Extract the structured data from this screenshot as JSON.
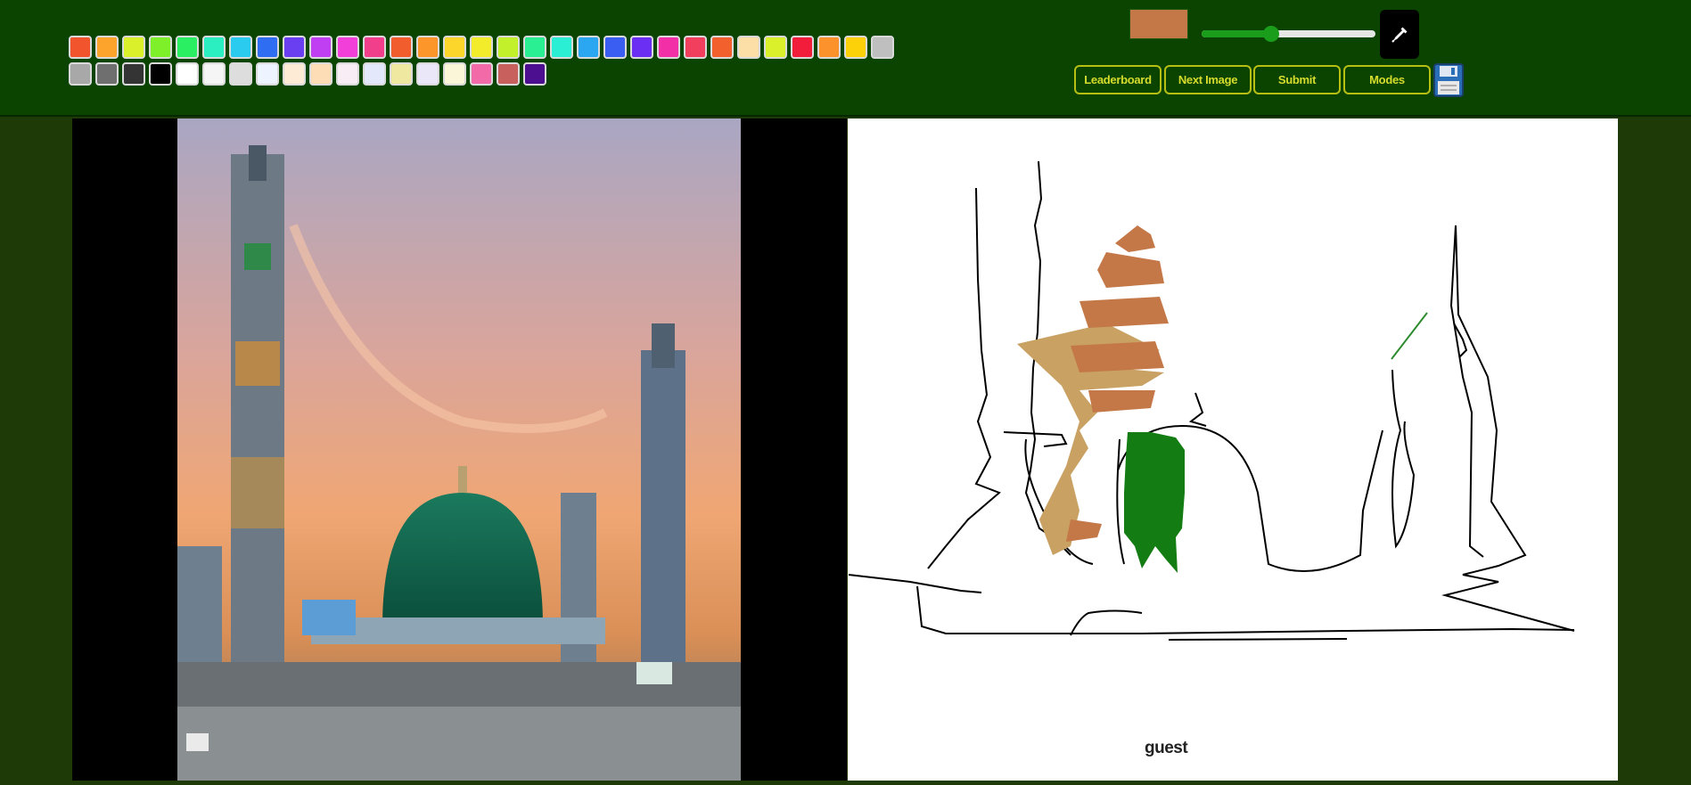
{
  "palette": {
    "row1": [
      "#f2542d",
      "#fca42b",
      "#d9f02a",
      "#7ef02a",
      "#2bef63",
      "#2befc0",
      "#2bcbf0",
      "#2f6ef2",
      "#6a3ff2",
      "#c03ff2",
      "#f23fd9",
      "#f23f8c",
      "#f25d2d",
      "#fc962b",
      "#fcd62b",
      "#f2ec2a",
      "#c2f02a",
      "#2bef93",
      "#2befd5",
      "#2ba6f0",
      "#3a5ef2",
      "#6a2ff2",
      "#f22fa6",
      "#f23f5e",
      "#f2602d",
      "#fcdfa6",
      "#d9f02a",
      "#f21d3a",
      "#fc922b",
      "#fcd10a",
      "#bfbfbf"
    ],
    "row2": [
      "#a8a8a8",
      "#6f6f6f",
      "#343434",
      "#000000",
      "#ffffff",
      "#f5f5f5",
      "#dddddd",
      "#eef4ff",
      "#fdebd6",
      "#fdddb5",
      "#f8ecf5",
      "#e4e8fb",
      "#efe8a0",
      "#eae7f9",
      "#fbf6d8",
      "#f26aa8",
      "#c8615e",
      "#4b0f8f"
    ]
  },
  "current_color": "#c47847",
  "brush_size": {
    "value": 0.4
  },
  "buttons": {
    "leaderboard": "Leaderboard",
    "next_image": "Next Image",
    "submit": "Submit",
    "modes": "Modes"
  },
  "icons": {
    "eyedropper": "eyedropper-icon",
    "save": "floppy-disk-icon"
  },
  "username": "guest"
}
